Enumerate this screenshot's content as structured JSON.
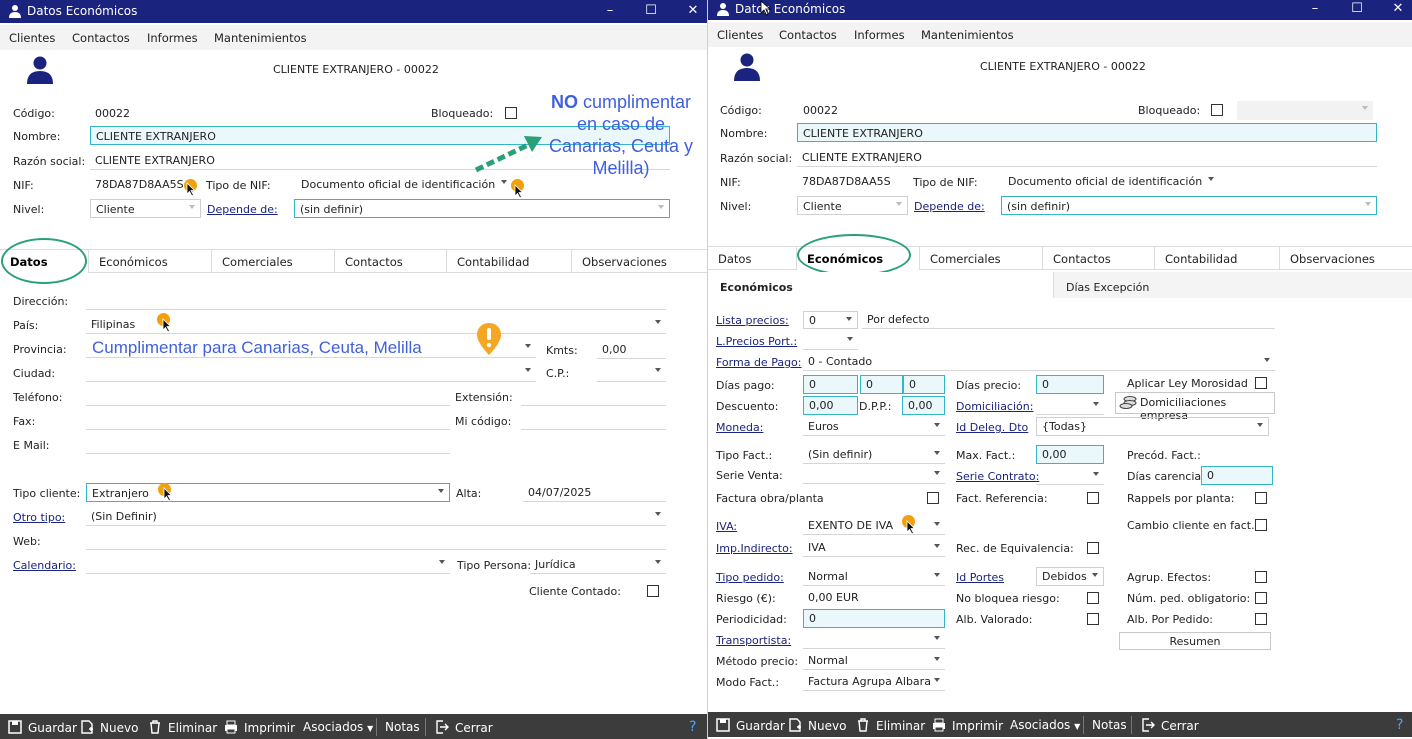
{
  "left": {
    "title": "Datos Económicos",
    "menu": [
      "Clientes",
      "Contactos",
      "Informes",
      "Mantenimientos"
    ],
    "header": "CLIENTE EXTRANJERO - 00022",
    "codigo_label": "Código:",
    "codigo": "00022",
    "bloqueado_label": "Bloqueado:",
    "nombre_label": "Nombre:",
    "nombre": "CLIENTE EXTRANJERO",
    "razon_label": "Razón social:",
    "razon": "CLIENTE EXTRANJERO",
    "nif_label": "NIF:",
    "nif": "78DA87D8AA5S",
    "tiponif_label": "Tipo de NIF:",
    "tiponif": "Documento oficial de identificación",
    "nivel_label": "Nivel:",
    "nivel": "Cliente",
    "depende_label": "Depende de:",
    "depende": "(sin definir)",
    "tabs": [
      "Datos",
      "Económicos",
      "Comerciales",
      "Contactos",
      "Contabilidad",
      "Observaciones"
    ],
    "direccion_label": "Dirección:",
    "pais_label": "País:",
    "pais": "Filipinas",
    "provincia_label": "Provincia:",
    "kmts_label": "Kmts:",
    "kmts": "0,00",
    "ciudad_label": "Ciudad:",
    "cp_label": "C.P.:",
    "telefono_label": "Teléfono:",
    "extension_label": "Extensión:",
    "fax_label": "Fax:",
    "micodigo_label": "Mi código:",
    "email_label": "E Mail:",
    "tipocliente_label": "Tipo cliente:",
    "tipocliente": "Extranjero",
    "alta_label": "Alta:",
    "alta": "04/07/2025",
    "otrotipo_label": "Otro tipo:",
    "otrotipo": "(Sin Definir)",
    "web_label": "Web:",
    "calendario_label": "Calendario:",
    "tipopersona_label": "Tipo Persona:",
    "tipopersona": "Jurídica",
    "contado_label": "Cliente Contado:",
    "annot_no_bold": "NO",
    "annot_no_rest": " cumplimentar en caso de Canarias, Ceuta y Melilla)",
    "annot_cumpl": "Cumplimentar para Canarias, Ceuta, Melilla",
    "toolbar": [
      "Guardar",
      "Nuevo",
      "Eliminar",
      "Imprimir",
      "Asociados",
      "Notas",
      "Cerrar"
    ]
  },
  "right": {
    "title": "Datos Económicos",
    "menu": [
      "Clientes",
      "Contactos",
      "Informes",
      "Mantenimientos"
    ],
    "header": "CLIENTE EXTRANJERO - 00022",
    "codigo_label": "Código:",
    "codigo": "00022",
    "bloqueado_label": "Bloqueado:",
    "nombre_label": "Nombre:",
    "nombre": "CLIENTE EXTRANJERO",
    "razon_label": "Razón social:",
    "razon": "CLIENTE EXTRANJERO",
    "nif_label": "NIF:",
    "nif": "78DA87D8AA5S",
    "tiponif_label": "Tipo de NIF:",
    "tiponif": "Documento oficial de identificación",
    "nivel_label": "Nivel:",
    "nivel": "Cliente",
    "depende_label": "Depende de:",
    "depende": "(sin definir)",
    "tabs": [
      "Datos",
      "Económicos",
      "Comerciales",
      "Contactos",
      "Contabilidad",
      "Observaciones"
    ],
    "subtabs": [
      "Económicos",
      "Días Excepción"
    ],
    "lista_label": "Lista precios:",
    "lista": "0",
    "lista_desc": "Por defecto",
    "lprecios_label": "L.Precios Port.:",
    "forma_label": "Forma de Pago:",
    "forma": "0 - Contado",
    "diaspago_label": "Días pago:",
    "diaspago": [
      "0",
      "0",
      "0"
    ],
    "diasprecio_label": "Días precio:",
    "diasprecio": "0",
    "morosidad_label": "Aplicar Ley Morosidad",
    "descuento_label": "Descuento:",
    "descuento": "0,00",
    "dpp_label": "D.P.P.:",
    "dpp": "0,00",
    "domiciliacion_label": "Domiciliación:",
    "domic_empresa": "Domiciliaciones empresa",
    "moneda_label": "Moneda:",
    "moneda": "Euros",
    "iddeleg_label": "Id Deleg. Dto",
    "iddeleg": "{Todas}",
    "tipofact_label": "Tipo Fact.:",
    "tipofact": "(Sin definir)",
    "maxfact_label": "Max. Fact.:",
    "maxfact": "0,00",
    "precod_label": "Precód. Fact.:",
    "serieventa_label": "Serie Venta:",
    "seriecontrato_label": "Serie Contrato:",
    "diascarencia_label": "Días carencia:",
    "diascarencia": "0",
    "facturaobra_label": "Factura obra/planta",
    "factref_label": "Fact. Referencia:",
    "rappels_label": "Rappels por planta:",
    "iva_label": "IVA:",
    "iva": "EXENTO DE IVA",
    "cambio_label": "Cambio cliente en fact.:",
    "impind_label": "Imp.Indirecto:",
    "impind": "IVA",
    "receq_label": "Rec. de Equivalencia:",
    "tipopedido_label": "Tipo pedido:",
    "tipopedido": "Normal",
    "idportes_label": "Id Portes",
    "idportes": "Debidos",
    "agrup_label": "Agrup. Efectos:",
    "riesgo_label": "Riesgo (€):",
    "riesgo": "0,00 EUR",
    "nobloquea_label": "No bloquea riesgo:",
    "numped_label": "Núm. ped. obligatorio:",
    "periodicidad_label": "Periodicidad:",
    "periodicidad": "0",
    "albval_label": "Alb. Valorado:",
    "albped_label": "Alb. Por Pedido:",
    "transportista_label": "Transportista:",
    "resumen": "Resumen",
    "metodo_label": "Método precio:",
    "metodo": "Normal",
    "modo_label": "Modo Fact.:",
    "modo": "Factura Agrupa Albara",
    "toolbar": [
      "Guardar",
      "Nuevo",
      "Eliminar",
      "Imprimir",
      "Asociados",
      "Notas",
      "Cerrar"
    ]
  },
  "colors": {
    "titlebar": "#1a237e",
    "accent_cyan": "#35b5c8",
    "annotation": "#3f5fe0",
    "oval": "#2aa078",
    "marker": "#f1a10c",
    "toolbar": "#3c3c3c"
  }
}
